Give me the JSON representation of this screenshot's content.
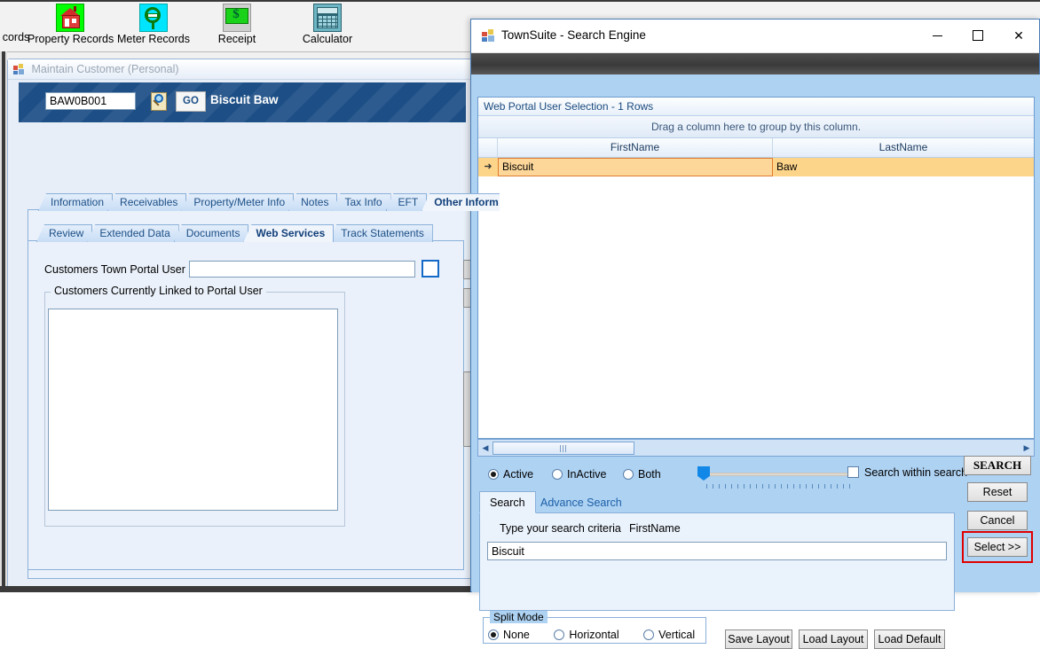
{
  "toolbar": {
    "items": [
      {
        "label": "cords",
        "icon": "records-icon"
      },
      {
        "label": "Property Records",
        "icon": "house-icon"
      },
      {
        "label": "Meter Records",
        "icon": "meter-icon"
      },
      {
        "label": "Receipt",
        "icon": "money-icon"
      },
      {
        "label": "Calculator",
        "icon": "calculator-icon"
      }
    ]
  },
  "mdi": {
    "title": "Maintain Customer (Personal)",
    "customer_id": "BAW0B001",
    "go_label": "GO",
    "customer_name": "Biscuit  Baw",
    "outer_tabs": [
      {
        "label": "Information",
        "selected": false
      },
      {
        "label": "Receivables",
        "selected": false
      },
      {
        "label": "Property/Meter Info",
        "selected": false
      },
      {
        "label": "Notes",
        "selected": false
      },
      {
        "label": "Tax Info",
        "selected": false
      },
      {
        "label": "EFT",
        "selected": false
      },
      {
        "label": "Other Inform",
        "selected": true
      }
    ],
    "inner_tabs": [
      {
        "label": "Review",
        "selected": false
      },
      {
        "label": "Extended Data",
        "selected": false
      },
      {
        "label": "Documents",
        "selected": false
      },
      {
        "label": "Web Services",
        "selected": true
      },
      {
        "label": "Track Statements",
        "selected": false
      }
    ],
    "web_services": {
      "portal_user_id_label": "Customers Town Portal User ID:",
      "portal_user_id_value": "",
      "linked_group_label": "Customers Currently Linked to Portal User"
    }
  },
  "dialog": {
    "title": "TownSuite - Search Engine",
    "window_icon": "app-icon",
    "minimize_label": "−",
    "maximize_label": "□",
    "close_label": "✕",
    "grid": {
      "caption": "Web Portal User Selection - 1 Rows",
      "group_hint": "Drag a column here to group by this column.",
      "columns": [
        "",
        "FirstName",
        "LastName"
      ],
      "rows": [
        {
          "indicator": "➜",
          "FirstName": "Biscuit",
          "LastName": "Baw"
        }
      ]
    },
    "scrollbar": {
      "left_arrow": "◀",
      "right_arrow": "▶"
    },
    "filters": {
      "options": [
        {
          "label": "Active",
          "selected": true
        },
        {
          "label": "InActive",
          "selected": false
        },
        {
          "label": "Both",
          "selected": false
        }
      ],
      "search_within_search": {
        "label": "Search within search",
        "checked": false
      }
    },
    "search_tabs": [
      {
        "label": "Search",
        "selected": true
      },
      {
        "label": "Advance Search",
        "selected": false
      }
    ],
    "search_panel": {
      "criteria_label": "Type your search criteria",
      "field_label": "FirstName",
      "input_value": "Biscuit",
      "input_placeholder": ""
    },
    "split_mode": {
      "title": "Split Mode",
      "options": [
        {
          "label": "None",
          "selected": true
        },
        {
          "label": "Horizontal",
          "selected": false
        },
        {
          "label": "Vertical",
          "selected": false
        }
      ]
    },
    "layout_buttons": [
      {
        "label": "Save Layout"
      },
      {
        "label": "Load Layout"
      },
      {
        "label": "Load Default"
      }
    ],
    "actions": {
      "search": "SEARCH",
      "reset": "Reset",
      "cancel": "Cancel",
      "select": "Select >>"
    }
  },
  "colors": {
    "dialog_bg": "#aed2f2",
    "banner_blue": "#1d4f86",
    "row_highlight": "#fcd48a",
    "row_border": "#e07b2e",
    "highlight_red": "#e00000",
    "slider_blue": "#1187e8"
  }
}
